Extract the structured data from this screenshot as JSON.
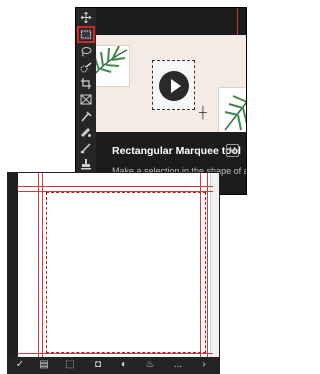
{
  "tooltip": {
    "title": "Rectangular Marquee tool",
    "shortcut": "M",
    "description": "Make a selection in the shape of a"
  },
  "tools": [
    {
      "name": "move-tool"
    },
    {
      "name": "rectangular-marquee-tool",
      "active": true
    },
    {
      "name": "lasso-tool"
    },
    {
      "name": "quick-selection-tool"
    },
    {
      "name": "crop-tool"
    },
    {
      "name": "frame-tool"
    },
    {
      "name": "eyedropper-tool"
    },
    {
      "name": "spot-healing-brush-tool"
    },
    {
      "name": "brush-tool"
    },
    {
      "name": "clone-stamp-tool"
    }
  ],
  "bottom_toolbar": {
    "overflow_label": "..."
  },
  "colors": {
    "accent": "#d4262b",
    "guide": "#d23b3b",
    "panel": "#1c1c1c"
  }
}
